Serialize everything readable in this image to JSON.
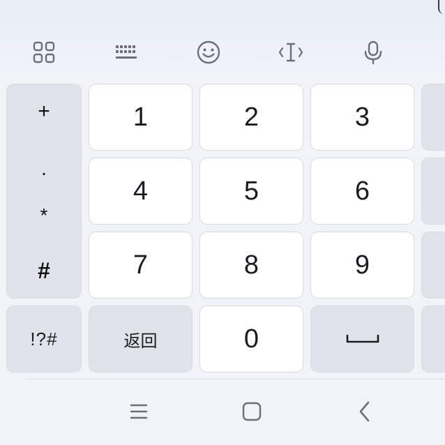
{
  "toolbar": {
    "icons": [
      "apps-grid-icon",
      "keyboard-icon",
      "emoji-icon",
      "cursor-edit-icon",
      "microphone-icon"
    ],
    "icon_color": "#6b6f76"
  },
  "symbol_column": {
    "plus": "+",
    "dot": ".",
    "star": "*",
    "hash": "#"
  },
  "numpad": {
    "keys": [
      {
        "label": "1"
      },
      {
        "label": "2"
      },
      {
        "label": "3"
      },
      {
        "label": "4"
      },
      {
        "label": "5"
      },
      {
        "label": "6"
      },
      {
        "label": "7"
      },
      {
        "label": "8"
      },
      {
        "label": "9"
      }
    ],
    "zero": "0"
  },
  "bottom_row": {
    "symbols_label": "!?#",
    "back_label": "返回",
    "space_icon": "space-bar-icon"
  },
  "nav_bar": {
    "icons": [
      "recent-apps-icon",
      "home-icon",
      "back-icon"
    ],
    "color": "#6b6f76"
  },
  "colors": {
    "background": "#f0f3f8",
    "key_light": "#ffffff",
    "key_dark": "#e0e4ea",
    "key_border": "#d7dbe2"
  }
}
